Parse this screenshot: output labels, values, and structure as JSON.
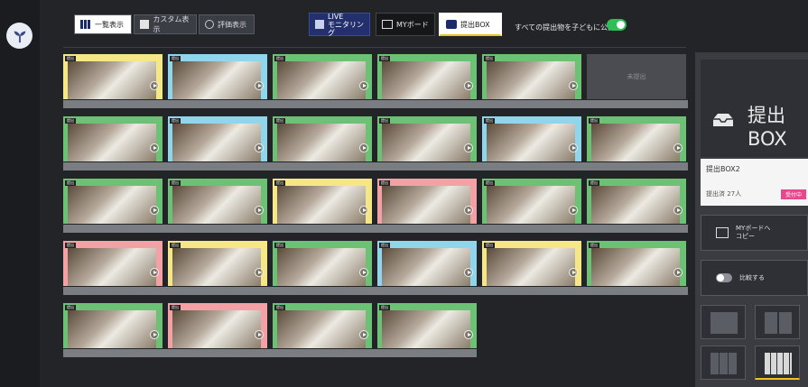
{
  "toolbar": {
    "list_view": "一覧表示",
    "custom_view": "カスタム表示",
    "evaluation_view": "評価表示",
    "live_monitoring_line1": "LIVE",
    "live_monitoring_line2": "モニタリング",
    "my_board": "MYボード",
    "submit_box": "提出BOX",
    "publish_all_label": "すべての提出物を子どもに公開",
    "publish_toggle_state": "on"
  },
  "grid": {
    "empty_label": "未提出",
    "tag_label": "提出",
    "rows": [
      [
        "yellow",
        "blue",
        "green",
        "green",
        "green",
        "empty"
      ],
      [
        "green",
        "blue",
        "green",
        "green",
        "blue",
        "green"
      ],
      [
        "green",
        "green",
        "yellow",
        "pink",
        "green",
        "green"
      ],
      [
        "pink",
        "yellow",
        "green",
        "blue",
        "yellow",
        "green"
      ],
      [
        "green",
        "pink",
        "green",
        "green"
      ]
    ]
  },
  "panel": {
    "title_line1": "提出",
    "title_line2": "BOX",
    "box_name": "提出BOX2",
    "submitted_count": "提出済 27人",
    "status_badge": "受付中",
    "copy_to_myboard_line1": "MYボードへ",
    "copy_to_myboard_line2": "コピー",
    "compare_label": "比較する"
  },
  "colors": {
    "yellow": "#f5e785",
    "blue": "#8fd6ec",
    "green": "#6cc274",
    "pink": "#f3a1a4",
    "accent": "#f1c21b",
    "toggle_on": "#2fbf5a"
  }
}
